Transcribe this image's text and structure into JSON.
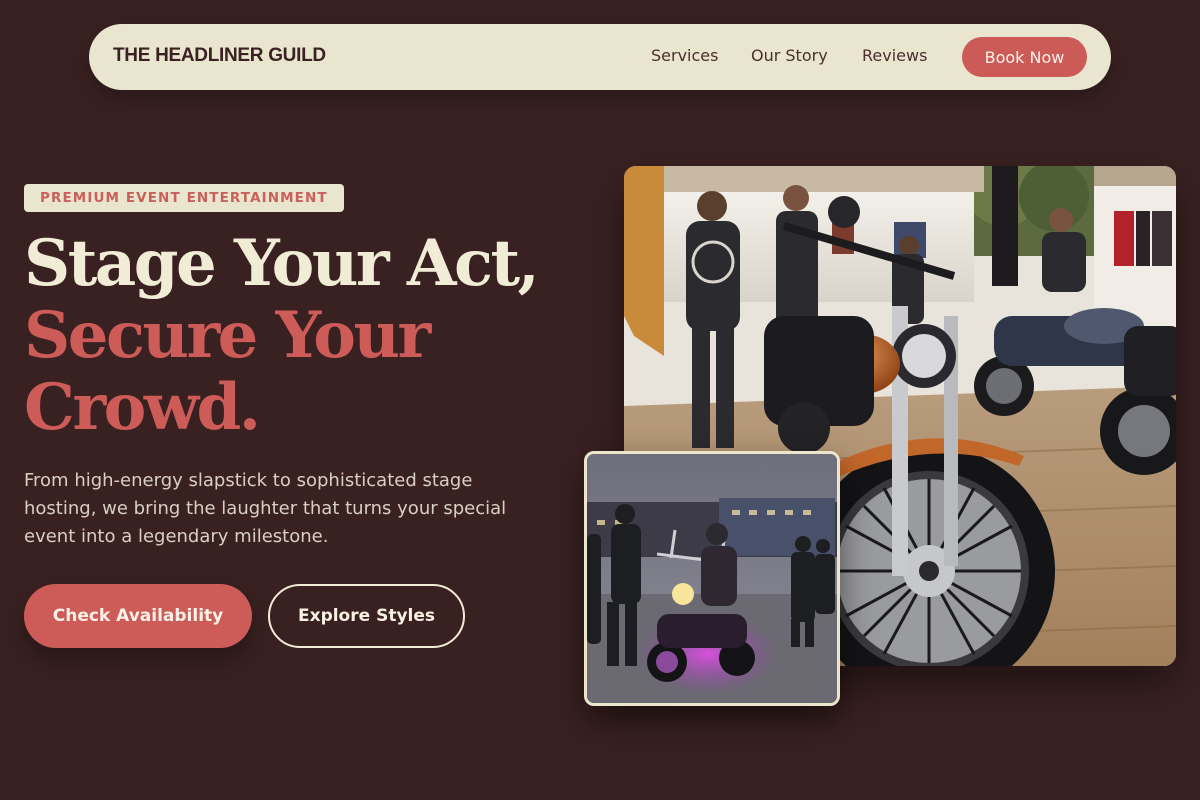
{
  "brand": {
    "name": "THE HEADLINER GUILD"
  },
  "nav": {
    "links": [
      {
        "label": "Services"
      },
      {
        "label": "Our Story"
      },
      {
        "label": "Reviews"
      }
    ],
    "cta_label": "Book Now"
  },
  "hero": {
    "badge": "PREMIUM EVENT ENTERTAINMENT",
    "headline_line1": "Stage Your Act,",
    "headline_accent_line1": "Secure Your",
    "headline_accent_line2": "Crowd.",
    "description": "From high-energy slapstick to sophisticated stage hosting, we bring the laughter that turns your special event into a legendary milestone.",
    "primary_cta": "Check Availability",
    "secondary_cta": "Explore Styles"
  },
  "images": {
    "main": {
      "subject": "motorcycles-on-display-photo"
    },
    "inset": {
      "subject": "motorcycle-riders-at-dusk-photo"
    }
  },
  "colors": {
    "background": "#3a2121",
    "cream": "#e9e5cf",
    "accent": "#cd5c59",
    "headline_light": "#f1ecd6"
  }
}
